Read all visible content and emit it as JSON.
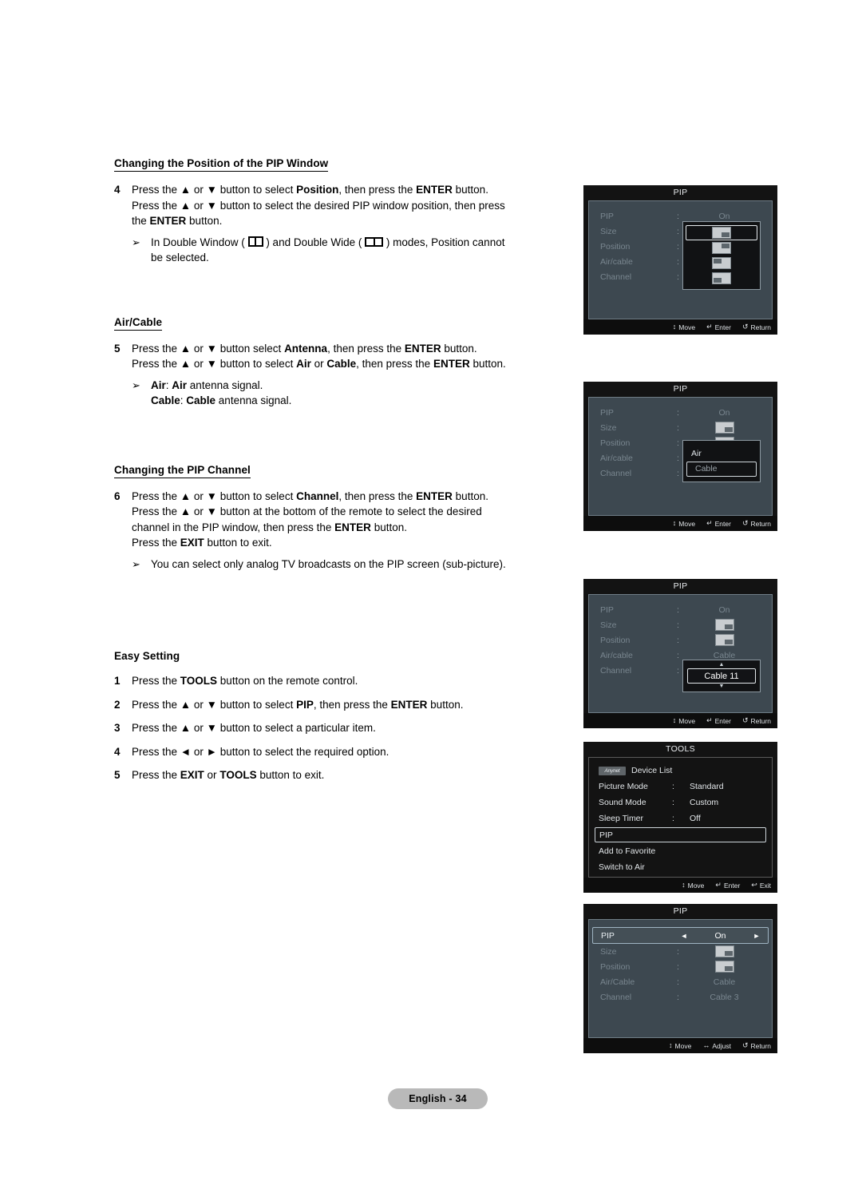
{
  "page": {
    "footer_label": "English - 34"
  },
  "sections": [
    {
      "heading": "Changing the Position of the PIP Window",
      "steps": [
        {
          "num": "4",
          "lines": [
            "Press the ▲ or ▼ button to select Position, then press the ENTER button.",
            "Press the ▲ or ▼ button to select the desired PIP window position, then press",
            "the ENTER button."
          ]
        }
      ],
      "note": {
        "bullet": "➢",
        "lines": [
          "In Double Window ( ) and Double Wide ( ) modes, Position cannot",
          "be selected."
        ],
        "text_a": "In Double Window (",
        "text_b": ") and Double Wide (",
        "text_c": ") modes, Position cannot be selected."
      }
    },
    {
      "heading": "Air/Cable",
      "steps": [
        {
          "num": "5",
          "lines": [
            "Press the ▲ or ▼ button select Antenna, then press the ENTER button.",
            "Press the ▲ or ▼ button to select Air or Cable, then press the ENTER button."
          ]
        }
      ],
      "note": {
        "bullet": "➢",
        "line1_bold": "Air",
        "line1_rest": ": Air antenna signal.",
        "line2_bold": "Cable",
        "line2_rest": ": Cable antenna signal."
      }
    },
    {
      "heading": "Changing the PIP Channel",
      "steps": [
        {
          "num": "6",
          "lines": [
            "Press the ▲ or ▼ button to select Channel, then press the ENTER button.",
            "Press the ▲ or ▼ button at the bottom of the remote to select the desired",
            "channel in the PIP window, then press the ENTER button.",
            "Press the EXIT button to exit."
          ]
        }
      ],
      "note": {
        "bullet": "➢",
        "text": "You can select only analog TV broadcasts on the PIP screen (sub-picture)."
      }
    },
    {
      "heading": "Easy Setting",
      "steps": [
        {
          "num": "1",
          "lines": [
            "Press the TOOLS button on the remote control."
          ]
        },
        {
          "num": "2",
          "lines": [
            "Press the ▲ or ▼ button to select PIP, then press the ENTER button."
          ]
        },
        {
          "num": "3",
          "lines": [
            "Press the ▲ or ▼ button to select a particular item."
          ]
        },
        {
          "num": "4",
          "lines": [
            "Press the ◄ or ► button to select the required option."
          ]
        },
        {
          "num": "5",
          "lines": [
            "Press the EXIT or TOOLS button to exit."
          ]
        }
      ]
    }
  ],
  "panel_position": {
    "title": "PIP",
    "rows": [
      {
        "label": "PIP",
        "colon": ":",
        "value": "On"
      },
      {
        "label": "Size",
        "colon": ":",
        "value": ""
      },
      {
        "label": "Position",
        "colon": ":",
        "value": ""
      },
      {
        "label": "Air/cable",
        "colon": ":",
        "value": ""
      },
      {
        "label": "Channel",
        "colon": ":",
        "value": ""
      }
    ],
    "footer": [
      {
        "glyph": "↕",
        "text": "Move"
      },
      {
        "glyph": "↵",
        "text": "Enter"
      },
      {
        "glyph": "↺",
        "text": "Return"
      }
    ]
  },
  "panel_aircable": {
    "title": "PIP",
    "rows": [
      {
        "label": "PIP",
        "colon": ":",
        "value": "On"
      },
      {
        "label": "Size",
        "colon": ":",
        "value": ""
      },
      {
        "label": "Position",
        "colon": ":",
        "value": ""
      },
      {
        "label": "Air/cable",
        "colon": ":",
        "value": ""
      },
      {
        "label": "Channel",
        "colon": ":",
        "value": ""
      }
    ],
    "popup_options": [
      {
        "label": "Air"
      },
      {
        "label": "Cable"
      }
    ],
    "footer": [
      {
        "glyph": "↕",
        "text": "Move"
      },
      {
        "glyph": "↵",
        "text": "Enter"
      },
      {
        "glyph": "↺",
        "text": "Return"
      }
    ]
  },
  "panel_channel": {
    "title": "PIP",
    "rows": [
      {
        "label": "PIP",
        "colon": ":",
        "value": "On"
      },
      {
        "label": "Size",
        "colon": ":",
        "value": ""
      },
      {
        "label": "Position",
        "colon": ":",
        "value": ""
      },
      {
        "label": "Air/cable",
        "colon": ":",
        "value": "Cable"
      },
      {
        "label": "Channel",
        "colon": ":",
        "value": ""
      }
    ],
    "channel_value": "Cable 11",
    "footer": [
      {
        "glyph": "↕",
        "text": "Move"
      },
      {
        "glyph": "↵",
        "text": "Enter"
      },
      {
        "glyph": "↺",
        "text": "Return"
      }
    ]
  },
  "panel_tools": {
    "title": "TOOLS",
    "anynet_badge": "Anynet",
    "rows": [
      {
        "label": "Device List",
        "colon": "",
        "value": ""
      },
      {
        "label": "Picture Mode",
        "colon": ":",
        "value": "Standard"
      },
      {
        "label": "Sound Mode",
        "colon": ":",
        "value": "Custom"
      },
      {
        "label": "Sleep Timer",
        "colon": ":",
        "value": "Off"
      },
      {
        "label": "PIP",
        "colon": "",
        "value": ""
      },
      {
        "label": "Add to Favorite",
        "colon": "",
        "value": ""
      },
      {
        "label": "Switch to Air",
        "colon": "",
        "value": ""
      }
    ],
    "footer": [
      {
        "glyph": "↕",
        "text": "Move"
      },
      {
        "glyph": "↵",
        "text": "Enter"
      },
      {
        "glyph": "↩",
        "text": "Exit"
      }
    ]
  },
  "panel_summary": {
    "title": "PIP",
    "rows": [
      {
        "label": "PIP",
        "colon": ":",
        "value": "On",
        "left_arrow": "◄",
        "right_arrow": "►"
      },
      {
        "label": "Size",
        "colon": ":",
        "value": ""
      },
      {
        "label": "Position",
        "colon": ":",
        "value": ""
      },
      {
        "label": "Air/Cable",
        "colon": ":",
        "value": "Cable"
      },
      {
        "label": "Channel",
        "colon": ":",
        "value": "Cable 3"
      }
    ],
    "footer": [
      {
        "glyph": "↕",
        "text": "Move"
      },
      {
        "glyph": "↔",
        "text": "Adjust"
      },
      {
        "glyph": "↺",
        "text": "Return"
      }
    ]
  }
}
